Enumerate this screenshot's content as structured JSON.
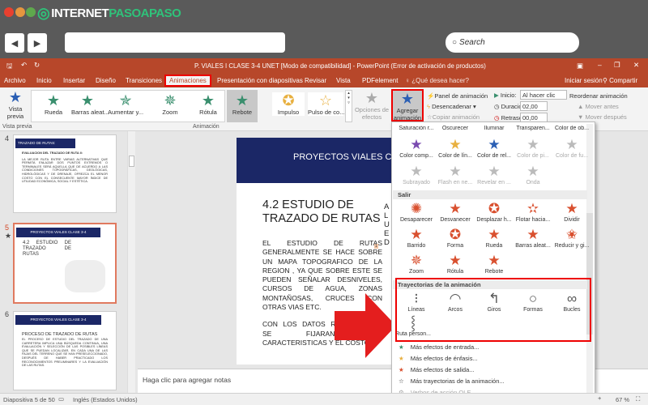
{
  "browser": {
    "logo_part1": "INTERNET",
    "logo_part2": "PASOAPASO",
    "search_placeholder": "Search",
    "back": "◀",
    "forward": "▶"
  },
  "window": {
    "title": "P. VIALES I  CLASE 3-4 UNET [Modo de compatibilidad] - PowerPoint (Error de activación de productos)"
  },
  "tabs": [
    "Archivo",
    "Inicio",
    "Insertar",
    "Diseño",
    "Transiciones",
    "Animaciones",
    "Presentación con diapositivas",
    "Revisar",
    "Vista",
    "PDFelement"
  ],
  "tell_me": "¿Qué desea hacer?",
  "signin": "Iniciar sesión",
  "share": "Compartir",
  "ribbon": {
    "preview": "Vista previa",
    "preview_group": "Vista previa",
    "gallery": [
      "Rueda",
      "Barras aleat...",
      "Aumentar y...",
      "Zoom",
      "Rótula",
      "Rebote",
      "Impulso",
      "Pulso de co..."
    ],
    "effect_options": "Opciones de efectos",
    "add_animation": "Agregar animación",
    "animation_pane": "Panel de animación",
    "trigger": "Desencadenar",
    "copy_animation": "Copiar animación",
    "start_label": "Inicio:",
    "start_value": "Al hacer clic",
    "duration_label": "Duración:",
    "duration_value": "02,00",
    "delay_label": "Retraso:",
    "delay_value": "00,00",
    "reorder": "Reordenar animación",
    "move_earlier": "Mover antes",
    "move_later": "Mover después",
    "animation_group": "Animación"
  },
  "thumbs": [
    {
      "num": "4",
      "header": "TRAZADO DE RUTAS:",
      "title": "EVALUACION DEL TRAZADO DE RUTA II:",
      "body": "LA MEJOR RUTA ENTRE VARIAS ALTERNATIVAS QUE PERMITA ENLAZAR DOS PUNTOS EXTREMOS O TERMINALES SERÁ AQUELLA QUE DE ACUERDO A LAS CONDICIONES TOPOGRÁFICAS, GEOLÓGICAS, HIDROLÓGICAS Y DE DRENAJE, OFREZCA EL MENOR COSTO CON EL CONSECUENTE MAYOR ÍNDICE DE UTILIDAD ECONÓMICA, SOCIAL Y ESTÉTICA."
    },
    {
      "num": "5",
      "header": "PROYECTOS VIALES  CLASE  3-4",
      "title": "4.2 ESTUDIO DE TRAZADO DE RUTAS"
    },
    {
      "num": "6",
      "header": "PROYECTOS VIALES  CLASE  3-4",
      "title": "PROCESO DE TRAZADO DE RUTAS",
      "body": "EL PROCESO DE ESTUDIO DEL TRAZADO DE UNA CARRETERA IMPLICA UNA BÚSQUEDA CONTINUA, UNA EVALUACIÓN Y SELECCIÓN DE LAS POSIBLES LÍNEAS QUE SE PUEDAN LOCALIZAR, EN CADA UNA DE LAS FAJAS DEL TERRENO QUE SE HAN PRESELECCIONADO, DESPUÉS DE HABER PRACTICADO LOS RECONOCIMIENTOS PRELIMINARES Y LA EVALUACIÓN DE LAS RUTAS."
    }
  ],
  "slide": {
    "header": "PROYECTOS VIALES  C",
    "title": "4.2 ESTUDIO DE TRAZADO DE RUTAS",
    "p1": "EL ESTUDIO DE RUTAS GENERALMENTE SE HACE SOBRE UN MAPA TOPOGRAFICO DE LA REGION , YA QUE SOBRE ESTE SE PUEDEN SEÑALAR DESNIVELES, CURSOS DE AGUA, ZONAS MONTAÑOSAS, CRUCES CON OTRAS VIAS ETC.",
    "p2": "CON LOS DATOS RECOPILADOS, SE FIJARAN LAS CARACTERISTICAS Y EL COSTO",
    "side": "A L U E D",
    "badge": "1"
  },
  "notes": "Haga clic para agregar notas",
  "status": {
    "slide": "Diapositiva 5 de 50",
    "lang": "Inglés (Estados Unidos)",
    "zoom": "67 %"
  },
  "dropdown": {
    "emphasis_row0": [
      "Saturación r...",
      "Oscurecer",
      "Iluminar",
      "Transparen...",
      "Color de ob..."
    ],
    "emphasis_row1": [
      "Color comp...",
      "Color de lín...",
      "Color de rel...",
      "Color de pi...",
      "Color de fu..."
    ],
    "emphasis_row2": [
      "Subrayado",
      "Flash en ne...",
      "Revelar en ...",
      "Onda"
    ],
    "exit_label": "Salir",
    "exit": [
      "Desaparecer",
      "Desvanecer",
      "Desplazar h...",
      "Flotar hacia...",
      "Dividir",
      "Barrido",
      "Forma",
      "Rueda",
      "Barras aleat...",
      "Reducir y gi...",
      "Zoom",
      "Rótula",
      "Rebote"
    ],
    "paths_label": "Trayectorias de la animación",
    "paths": [
      "Líneas",
      "Arcos",
      "Giros",
      "Formas",
      "Bucles",
      "Ruta person..."
    ],
    "more": [
      "Más efectos de entrada...",
      "Más efectos de énfasis...",
      "Más efectos de salida...",
      "Más trayectorias de la animación...",
      "Verbos de acción OLE..."
    ]
  },
  "colors": {
    "accent": "#b7472a",
    "highlight": "#e00000",
    "slide_header": "#1b2766",
    "exit": "#d9502f",
    "entrance": "#3a8f6e",
    "emphasis": "#e8b040"
  }
}
